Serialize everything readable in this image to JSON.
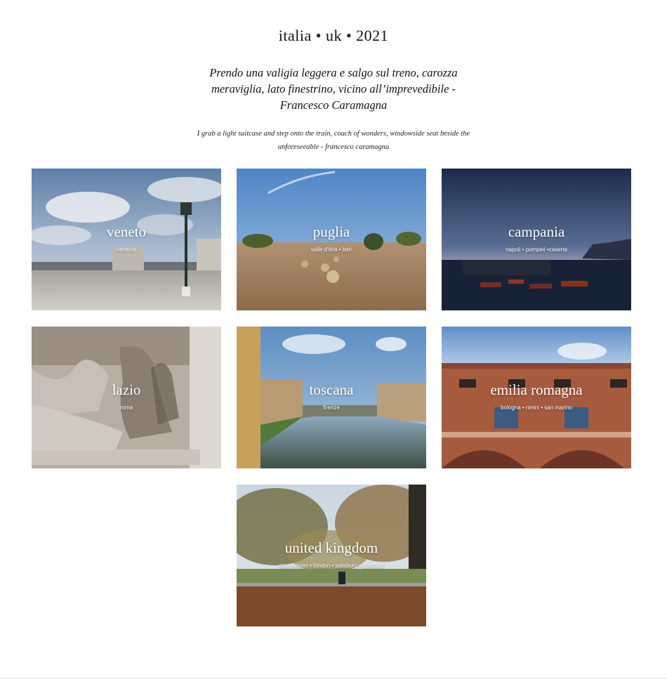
{
  "header": {
    "title": "italia • uk • 2021",
    "quote_italian": "Prendo una valigia leggera e salgo sul treno, carozza meraviglia, lato finestrino, vicino all’imprevedibile - Francesco Caramagna",
    "quote_english": "I grab a light suitcase and step onto the train, coach of wonders, windowside seat beside the unforeseeable - francesco caramagna"
  },
  "gallery": [
    {
      "title": "veneto",
      "subtitle": "venezia"
    },
    {
      "title": "puglia",
      "subtitle": "valle d'itria • bari"
    },
    {
      "title": "campania",
      "subtitle": "napoli • pompeii •caserta"
    },
    {
      "title": "lazio",
      "subtitle": "roma"
    },
    {
      "title": "toscana",
      "subtitle": "firenze"
    },
    {
      "title": "emilia romagna",
      "subtitle": "bologna • rimini • san marino"
    },
    {
      "title": "united kingdom",
      "subtitle": "manchester • london • salisbury • guildford"
    }
  ]
}
